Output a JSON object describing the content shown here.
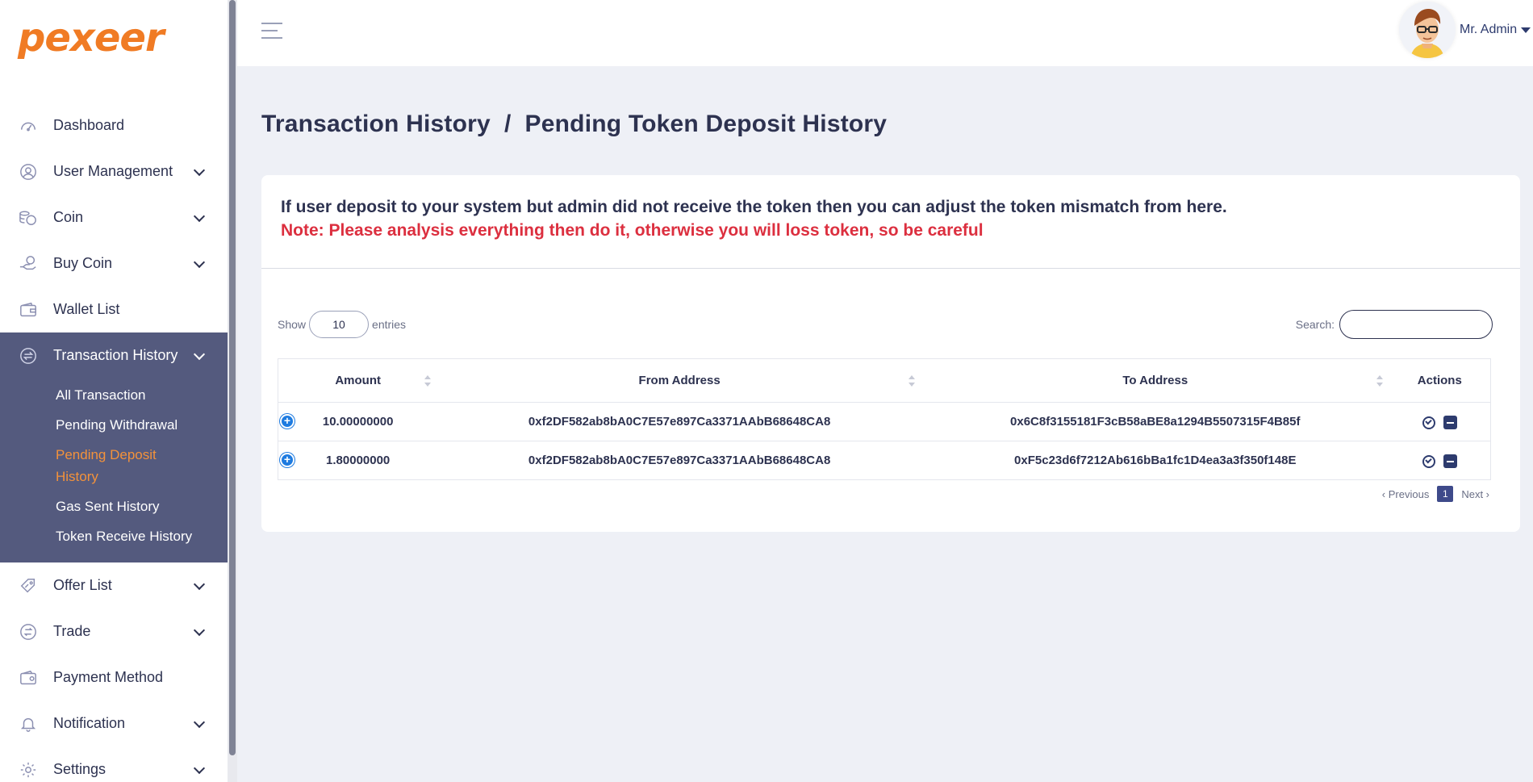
{
  "brand": {
    "logo_text": "pexeer",
    "accent": "#f07b24"
  },
  "sidebar": {
    "items": [
      {
        "label": "Dashboard",
        "icon": "speedometer-icon",
        "has_children": false
      },
      {
        "label": "User Management",
        "icon": "user-circle-icon",
        "has_children": true
      },
      {
        "label": "Coin",
        "icon": "coins-icon",
        "has_children": true
      },
      {
        "label": "Buy Coin",
        "icon": "hand-coin-icon",
        "has_children": true
      },
      {
        "label": "Wallet List",
        "icon": "wallet-icon",
        "has_children": false
      }
    ],
    "active_group": {
      "label": "Transaction History",
      "icon": "exchange-icon",
      "children": [
        {
          "label": "All Transaction"
        },
        {
          "label": "Pending Withdrawal"
        },
        {
          "label": "Pending Deposit History",
          "active": true
        },
        {
          "label": "Gas Sent History"
        },
        {
          "label": "Token Receive History"
        }
      ]
    },
    "items_after": [
      {
        "label": "Offer List",
        "icon": "offer-tag-icon",
        "has_children": true
      },
      {
        "label": "Trade",
        "icon": "trade-icon",
        "has_children": true
      },
      {
        "label": "Payment Method",
        "icon": "payment-wallet-icon",
        "has_children": false
      },
      {
        "label": "Notification",
        "icon": "bell-icon",
        "has_children": true
      },
      {
        "label": "Settings",
        "icon": "gear-icon",
        "has_children": true
      }
    ]
  },
  "header": {
    "user_name": "Mr. Admin"
  },
  "page": {
    "title": "Transaction History  /  Pending Token Deposit History",
    "notice_line1": "If user deposit to your system but admin did not receive the token then you can adjust the token mismatch from here.",
    "notice_line2": "Note: Please analysis everything then do it, otherwise you will loss token, so be careful"
  },
  "table": {
    "show_label": "Show",
    "entries_value": "10",
    "entries_label": "entries",
    "search_label": "Search:",
    "search_value": "",
    "columns": [
      "Amount",
      "From Address",
      "To Address",
      "Actions"
    ],
    "rows": [
      {
        "amount": "10.00000000",
        "from": "0xf2DF582ab8bA0C7E57e897Ca3371AAbB68648CA8",
        "to": "0x6C8f3155181F3cB58aBE8a1294B5507315F4B85f"
      },
      {
        "amount": "1.80000000",
        "from": "0xf2DF582ab8bA0C7E57e897Ca3371AAbB68648CA8",
        "to": "0xF5c23d6f7212Ab616bBa1fc1D4ea3a3f350f148E"
      }
    ],
    "pagination": {
      "prev": "‹ Previous",
      "current": "1",
      "next": "Next ›"
    }
  }
}
